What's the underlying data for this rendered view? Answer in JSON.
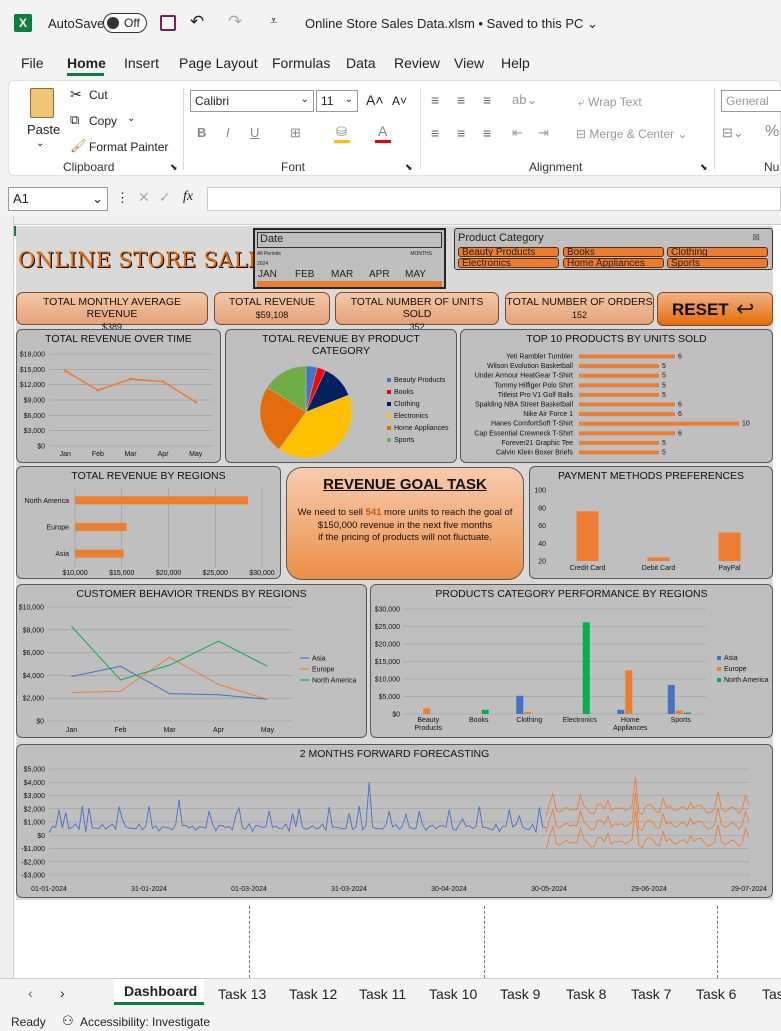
{
  "app": {
    "autosave": "AutoSave",
    "autosave_state": "Off",
    "filename": "Online Store Sales Data.xlsm",
    "saved": "Saved to this PC"
  },
  "menu": [
    "File",
    "Home",
    "Insert",
    "Page Layout",
    "Formulas",
    "Data",
    "Review",
    "View",
    "Help"
  ],
  "ribbon": {
    "paste": "Paste",
    "cut": "Cut",
    "copy": "Copy",
    "format_painter": "Format Painter",
    "clipboard": "Clipboard",
    "font_name": "Calibri",
    "font_size": "11",
    "font": "Font",
    "wrap": "Wrap Text",
    "merge": "Merge & Center",
    "alignment": "Alignment",
    "number_format": "General",
    "number": "Nu"
  },
  "formula": {
    "cell": "A1",
    "fx": "fx"
  },
  "dashboard": {
    "title": "ONLINE STORE SALES",
    "date_slicer": {
      "label": "Date",
      "all": "All Periods",
      "unit": "MONTHS",
      "year": "2024",
      "months": [
        "JAN",
        "FEB",
        "MAR",
        "APR",
        "MAY"
      ]
    },
    "category_slicer": {
      "label": "Product Category",
      "items": [
        "Beauty Products",
        "Books",
        "Clothing",
        "Electronics",
        "Home Appliances",
        "Sports"
      ]
    },
    "kpis": [
      {
        "label": "TOTAL MONTHLY AVERAGE REVENUE",
        "value": "$389"
      },
      {
        "label": "TOTAL REVENUE",
        "value": "$59,108"
      },
      {
        "label": "TOTAL NUMBER OF UNITS SOLD",
        "value": "352"
      },
      {
        "label": "TOTAL NUMBER OF ORDERS",
        "value": "152"
      }
    ],
    "reset": "RESET",
    "goal": {
      "title": "REVENUE GOAL TASK",
      "l1a": "We need to sell ",
      "units": "541",
      "l1b": " more units to reach the goal of",
      "l2": "$150,000 revenue in the next five months",
      "l3": "if the pricing of products will not fluctuate."
    }
  },
  "chart_data": [
    {
      "type": "line",
      "title": "TOTAL REVENUE OVER TIME",
      "categories": [
        "Jan",
        "Feb",
        "Mar",
        "Apr",
        "May"
      ],
      "values": [
        14700,
        10900,
        13100,
        12600,
        8600
      ],
      "yticks": [
        "$0",
        "$3,000",
        "$6,000",
        "$9,000",
        "$12,000",
        "$15,000",
        "$18,000"
      ],
      "ylim": [
        0,
        18000
      ],
      "color": "#ed7d31"
    },
    {
      "type": "pie",
      "title": "TOTAL REVENUE BY PRODUCT CATEGORY",
      "labels": [
        "Beauty Products",
        "Books",
        "Clothing",
        "Electronics",
        "Home Appliances",
        "Sports"
      ],
      "values": [
        4,
        3,
        12,
        41,
        24,
        16
      ],
      "colors": [
        "#4472c4",
        "#ff0000",
        "#002060",
        "#ffc000",
        "#e46c0a",
        "#70ad47"
      ]
    },
    {
      "type": "bar",
      "title": "TOP 10 PRODUCTS BY UNITS SOLD",
      "categories": [
        "Yeti Rambler Tumbler",
        "Wilson Evolution Basketball",
        "Under Armour HeatGear T-Shirt",
        "Tommy Hilfiger Polo Shirt",
        "Titleist Pro V1 Golf Balls",
        "Spalding NBA Street Basketball",
        "Nike Air Force 1",
        "Hanes ComfortSoft T-Shirt",
        "Cap Essential Crewneck T-Shirt",
        "Forever21 Graphic Tee",
        "Calvin Klein Boxer Briefs"
      ],
      "values": [
        6,
        5,
        5,
        5,
        5,
        6,
        6,
        10,
        6,
        5,
        5
      ],
      "color": "#ed7d31"
    },
    {
      "type": "bar",
      "title": "TOTAL REVENUE BY REGIONS",
      "categories": [
        "North America",
        "Europe",
        "Asia"
      ],
      "values": [
        28500,
        15500,
        15200
      ],
      "xticks": [
        "$10,000",
        "$15,000",
        "$20,000",
        "$25,000",
        "$30,000"
      ],
      "xlim": [
        10000,
        30000
      ],
      "color": "#ed7d31"
    },
    {
      "type": "bar",
      "title": "PAYMENT METHODS PREFERENCES",
      "categories": [
        "Credit Card",
        "Debit Card",
        "PayPal"
      ],
      "values": [
        76,
        24,
        52
      ],
      "ylim": [
        20,
        100
      ],
      "yticks": [
        "20",
        "40",
        "60",
        "80",
        "100"
      ],
      "color": "#ed7d31"
    },
    {
      "type": "line",
      "title": "CUSTOMER BEHAVIOR TRENDS BY REGIONS",
      "categories": [
        "Jan",
        "Feb",
        "Mar",
        "Apr",
        "May"
      ],
      "ylim": [
        0,
        10000
      ],
      "yticks": [
        "$0",
        "$2,000",
        "$4,000",
        "$6,000",
        "$8,000",
        "$10,000"
      ],
      "series": [
        {
          "name": "Asia",
          "values": [
            3900,
            4800,
            2400,
            2300,
            1900
          ],
          "color": "#4472c4"
        },
        {
          "name": "Europe",
          "values": [
            2500,
            2600,
            5600,
            3200,
            1900
          ],
          "color": "#ed7d31"
        },
        {
          "name": "North America",
          "values": [
            8300,
            3600,
            4900,
            7000,
            4800
          ],
          "color": "#00b050"
        }
      ]
    },
    {
      "type": "bar",
      "title": "PRODUCTS CATEGORY PERFORMANCE BY REGIONS",
      "categories": [
        "Beauty Products",
        "Books",
        "Clothing",
        "Electronics",
        "Home Appliances",
        "Sports"
      ],
      "ylim": [
        0,
        30000
      ],
      "yticks": [
        "$0",
        "$5,000",
        "$10,000",
        "$15,000",
        "$20,000",
        "$25,000",
        "$30,000"
      ],
      "series": [
        {
          "name": "Asia",
          "values": [
            0,
            0,
            5200,
            0,
            1200,
            8300
          ],
          "color": "#4472c4"
        },
        {
          "name": "Europe",
          "values": [
            1600,
            0,
            600,
            0,
            12500,
            1000
          ],
          "color": "#ed7d31"
        },
        {
          "name": "North America",
          "values": [
            0,
            1200,
            0,
            26200,
            0,
            400
          ],
          "color": "#00b050"
        }
      ]
    },
    {
      "type": "line",
      "title": "2 MONTHS FORWARD FORECASTING",
      "xticks": [
        "01-01-2024",
        "31-01-2024",
        "01-03-2024",
        "31-03-2024",
        "30-04-2024",
        "30-05-2024",
        "29-06-2024",
        "29-07-2024"
      ],
      "yticks": [
        "-$3,000",
        "-$2,000",
        "-$1,000",
        "$0",
        "$1,000",
        "$2,000",
        "$3,000",
        "$4,000",
        "$5,000"
      ],
      "ylim": [
        -3000,
        5000
      ]
    }
  ],
  "sheet_tabs": [
    "Dashboard",
    "Task 13",
    "Task 12",
    "Task 11",
    "Task 10",
    "Task 9",
    "Task 8",
    "Task 7",
    "Task 6",
    "Tas"
  ],
  "status": {
    "ready": "Ready",
    "accessibility": "Accessibility: Investigate"
  }
}
